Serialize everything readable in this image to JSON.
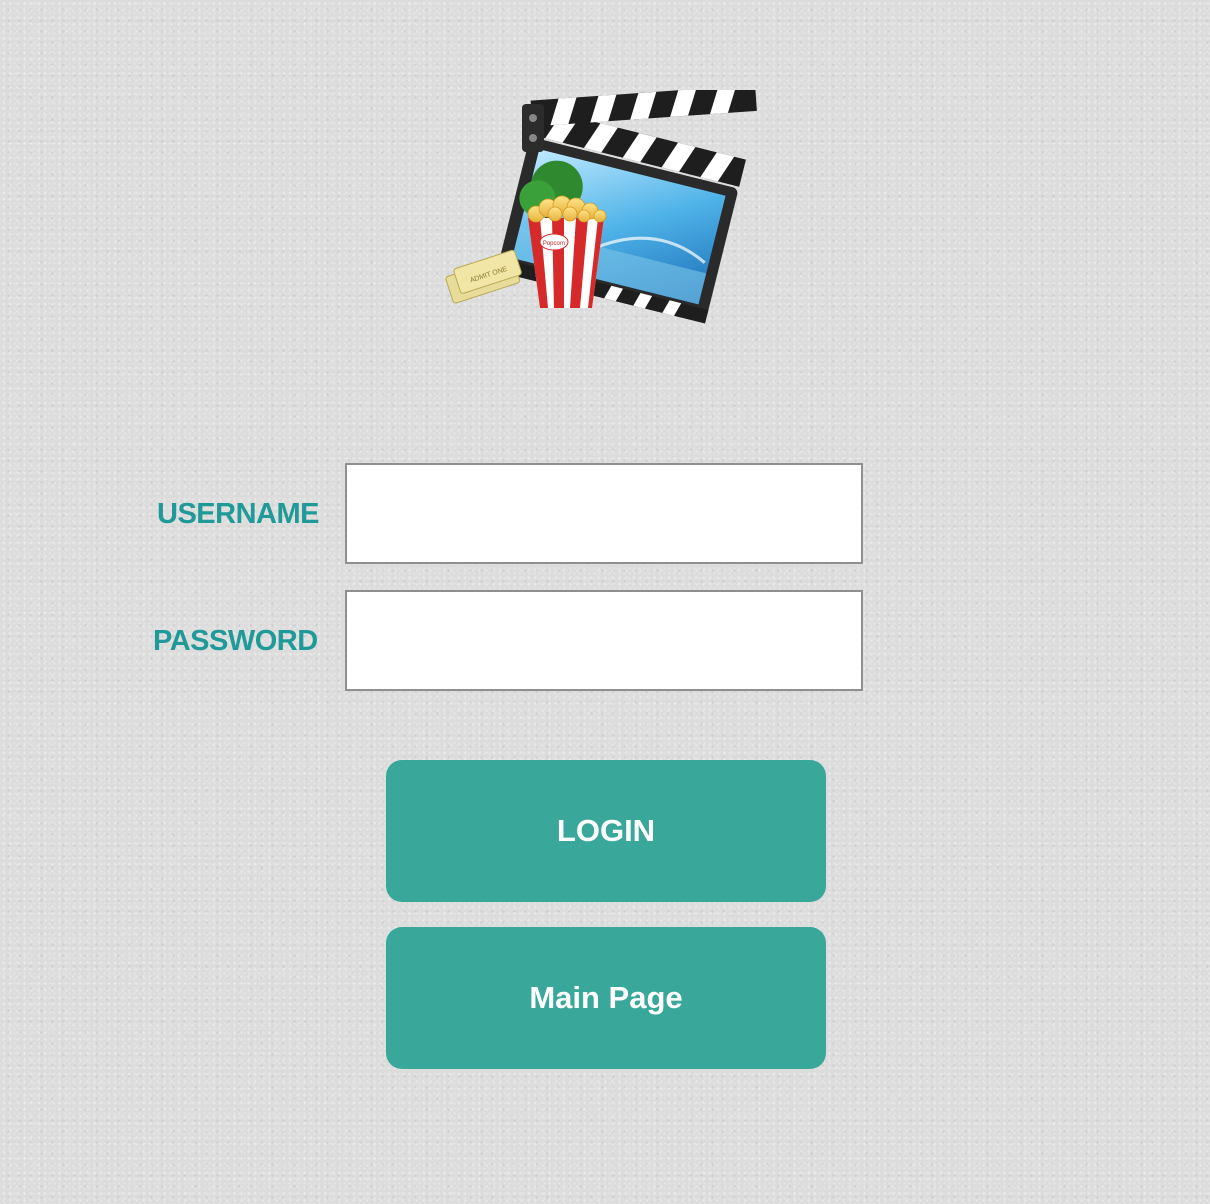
{
  "logo": {
    "icon": "movie-clapperboard-popcorn-icon",
    "popcorn_text": "Popcorn",
    "ticket_text": "ADMIT ONE"
  },
  "form": {
    "username_label": "USERNAME",
    "username_value": "",
    "password_label": "PASSWORD",
    "password_value": ""
  },
  "buttons": {
    "login_label": "LOGIN",
    "main_page_label": "Main Page"
  },
  "colors": {
    "accent": "#39a89b",
    "label": "#1f9a98",
    "background": "#dcdcdc"
  }
}
